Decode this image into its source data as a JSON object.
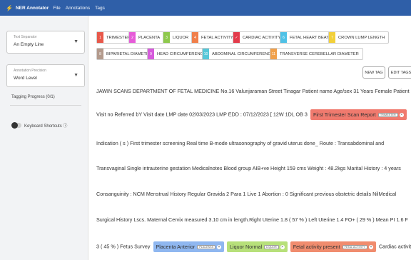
{
  "topbar": {
    "app_name": "NER Annotator",
    "menu": [
      "File",
      "Annotations",
      "Tags"
    ]
  },
  "sidebar": {
    "separator": {
      "label": "Text Separator",
      "value": "An Empty Line"
    },
    "precision": {
      "label": "Annotation Precision",
      "value": "Word Level"
    },
    "progress_label": "Tagging Progress (0/1)",
    "shortcuts_label": "Keyboard Shortcuts"
  },
  "tags": [
    {
      "num": "1",
      "label": "TRIMESTER",
      "color": "#e8584a"
    },
    {
      "num": "2",
      "label": "PLACENTA",
      "color": "#e65bd8"
    },
    {
      "num": "3",
      "label": "LIQUOR",
      "color": "#8ec94c"
    },
    {
      "num": "4",
      "label": "FETAL ACTIVITY",
      "color": "#f07f4a"
    },
    {
      "num": "5",
      "label": "CARDIAC ACTIVITY",
      "color": "#e33b4b"
    },
    {
      "num": "6",
      "label": "FETAL HEART BEAT",
      "color": "#4fc1e6"
    },
    {
      "num": "7",
      "label": "CROWN LUMP LENGTH",
      "color": "#f2d03a"
    },
    {
      "num": "8",
      "label": "BIPARIETAL DIAMETER",
      "color": "#b39a8c"
    },
    {
      "num": "9",
      "label": "HEAD CIRCUMFERENCE",
      "color": "#d65bdc"
    },
    {
      "num": "10",
      "label": "ABDOMINAL CIRCUMFERENCE",
      "color": "#56c7d8"
    },
    {
      "num": "11",
      "label": "TRANSVERSE CEREBELLAR DIAMETER",
      "color": "#f0a04a"
    }
  ],
  "buttons": {
    "new_tag": "NEW TAG",
    "edit_tags": "EDIT TAGS"
  },
  "doc": {
    "line0": "JAWIN SCANS DEPARTMENT OF FETAL MEDICINE No.16 Valunjaraman Street Tinagar Patient name Age/sex 31 Years Female Patient ID",
    "line1_pre": "Visit no Referred bY Visit date LMP date 02/03/2023 LMP EDD : 07/12/2023 [ 12W 1DL OB 3",
    "ent_trimester": {
      "text": "First Trimester Scan Report",
      "tag": "TRIMESTER",
      "color": "#f07a6e"
    },
    "line2": "Indication ( s ) First trimester screening Real time B-mode ultrasonography of gravid uterus done_ Route : Transabdominal and",
    "line3": "Transvaginal Single intrauterine gestation Medicalnotes Blood group AIB+ve Height 159 cms Weight : 48.2kgs Marital History : 4 years",
    "line4": "Consanguinity : NCM Menstrual History Regular Gravida 2 Para 1 Live 1 Abortion : 0 Significant previous obstetric details NilMedical",
    "line5": "Surgical History Lscs. Maternal Cervix measured 3.10 cm in length.Right Uterine 1.8 ( 57 % ) Left Uterine 1.4 FO+ ( 29 % ) Mean PI 1.6 F",
    "line6_pre": "3 ( 45 % ) Fetus Survey",
    "ent_placenta": {
      "text": "Placenta Anterior",
      "tag": "PLACENTA",
      "color": "#8fb7f0"
    },
    "ent_liquor": {
      "text": "Liquor Normal",
      "tag": "LIQUOR",
      "color": "#b7e07a"
    },
    "ent_fetal": {
      "text": "Fetal activity present",
      "tag": "FETAL ACTIVITY",
      "color": "#f08c6e"
    },
    "line6_post": "Cardiac activity"
  }
}
